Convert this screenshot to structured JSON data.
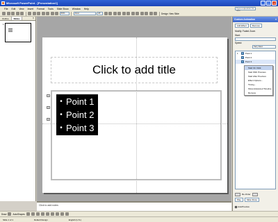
{
  "window": {
    "title": "Microsoft PowerPoint - [Presentation1]"
  },
  "menu": [
    "File",
    "Edit",
    "View",
    "Insert",
    "Format",
    "Tools",
    "Slide Show",
    "Window",
    "Help"
  ],
  "help_box": "Type a question for help",
  "toolbar": {
    "zoom": "66%",
    "font": "Arial",
    "size": "18",
    "design": "Design",
    "new_slide": "New Slide"
  },
  "outline_pane": {
    "tabs": [
      "Outline",
      "Slides"
    ],
    "active_tab": "Slides",
    "slide_number": "1"
  },
  "slide": {
    "title_placeholder": "Click to add title",
    "bullets": [
      "Point 1",
      "Point 2",
      "Point 3"
    ],
    "anim_tags": [
      "1",
      "2",
      "3"
    ]
  },
  "notes": {
    "placeholder": "Click to add notes"
  },
  "task_pane": {
    "title": "Custom Animation",
    "add_effect": "Add Effect",
    "remove": "Remove",
    "section_label": "Modify: Faded Zoom",
    "start_label": "Start:",
    "start_value": "",
    "property_label": "Speed:",
    "speed_value": "Very Fast",
    "items": [
      {
        "num": "1",
        "label": "Point 1"
      },
      {
        "num": "",
        "label": "Point 2"
      },
      {
        "num": "",
        "label": "Point 3"
      }
    ],
    "context_menu": [
      "Start On Click",
      "Start With Previous",
      "Start After Previous",
      "Effect Options...",
      "Timing...",
      "Show Advanced Timeline",
      "Remove"
    ],
    "context_selected": "Start On Click",
    "reorder_label": "Re-Order",
    "play": "Play",
    "slide_show": "Slide Show",
    "autopreview": "AutoPreview"
  },
  "drawbar": {
    "draw": "Draw",
    "autoshapes": "AutoShapes"
  },
  "status": {
    "slide": "Slide 1 of 1",
    "design": "Default Design",
    "language": "English (U.S.)"
  }
}
